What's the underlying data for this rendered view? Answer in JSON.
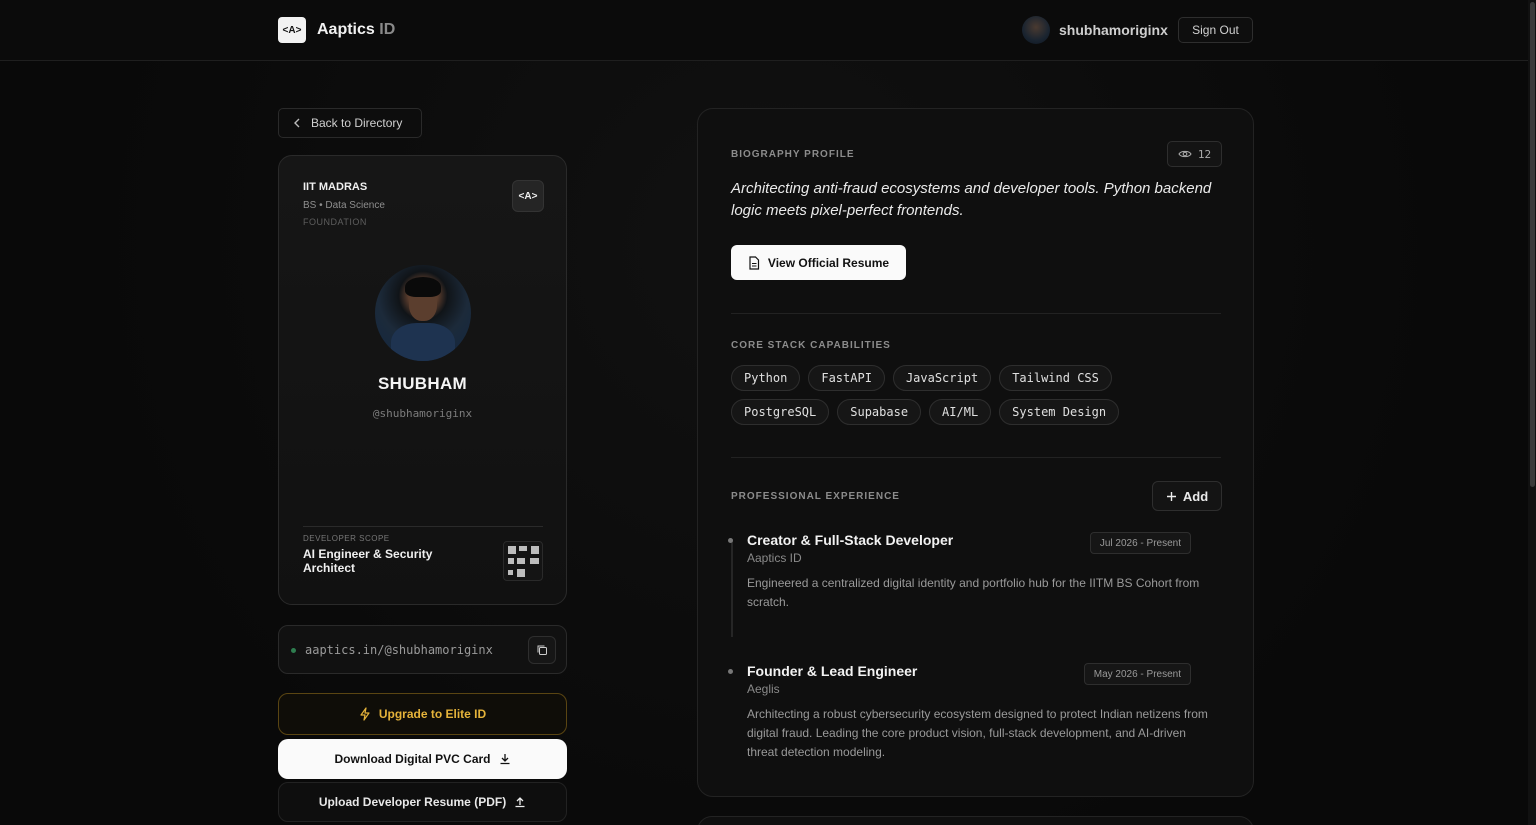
{
  "header": {
    "logo_text": "<A>",
    "brand_main": "Aaptics",
    "brand_suffix": "ID",
    "username": "shubhamoriginx",
    "sign_out": "Sign Out"
  },
  "back_label": "Back to Directory",
  "id_card": {
    "university": "IIT MADRAS",
    "program": "BS • Data Science",
    "level": "FOUNDATION",
    "logo_text": "<A>",
    "name": "SHUBHAM",
    "handle": "@shubhamoriginx",
    "scope_label": "DEVELOPER SCOPE",
    "scope_value": "AI Engineer & Security Architect"
  },
  "profile_url": "aaptics.in/@shubhamoriginx",
  "actions": {
    "upgrade": "Upgrade to Elite ID",
    "download": "Download Digital PVC Card",
    "upload": "Upload Developer Resume (PDF)"
  },
  "bio_section": {
    "label": "BIOGRAPHY PROFILE",
    "views": "12",
    "text": "Architecting anti-fraud ecosystems and developer tools. Python backend logic meets pixel-perfect frontends.",
    "resume_button": "View Official Resume"
  },
  "stack_section": {
    "label": "CORE STACK CAPABILITIES",
    "chips": [
      "Python",
      "FastAPI",
      "JavaScript",
      "Tailwind CSS",
      "PostgreSQL",
      "Supabase",
      "AI/ML",
      "System Design"
    ]
  },
  "experience_section": {
    "label": "PROFESSIONAL EXPERIENCE",
    "add_label": "Add",
    "items": [
      {
        "title": "Creator & Full-Stack Developer",
        "org": "Aaptics ID",
        "date": "Jul 2026 - Present",
        "desc": "Engineered a centralized digital identity and portfolio hub for the IITM BS Cohort from scratch."
      },
      {
        "title": "Founder & Lead Engineer",
        "org": "Aeglis",
        "date": "May 2026 - Present",
        "desc": "Architecting a robust cybersecurity ecosystem designed to protect Indian netizens from digital fraud. Leading the core product vision, full-stack development, and AI-driven threat detection modeling."
      }
    ]
  },
  "colors": {
    "accent_gold": "#e5b33a",
    "status_green": "#2e7d4f"
  }
}
